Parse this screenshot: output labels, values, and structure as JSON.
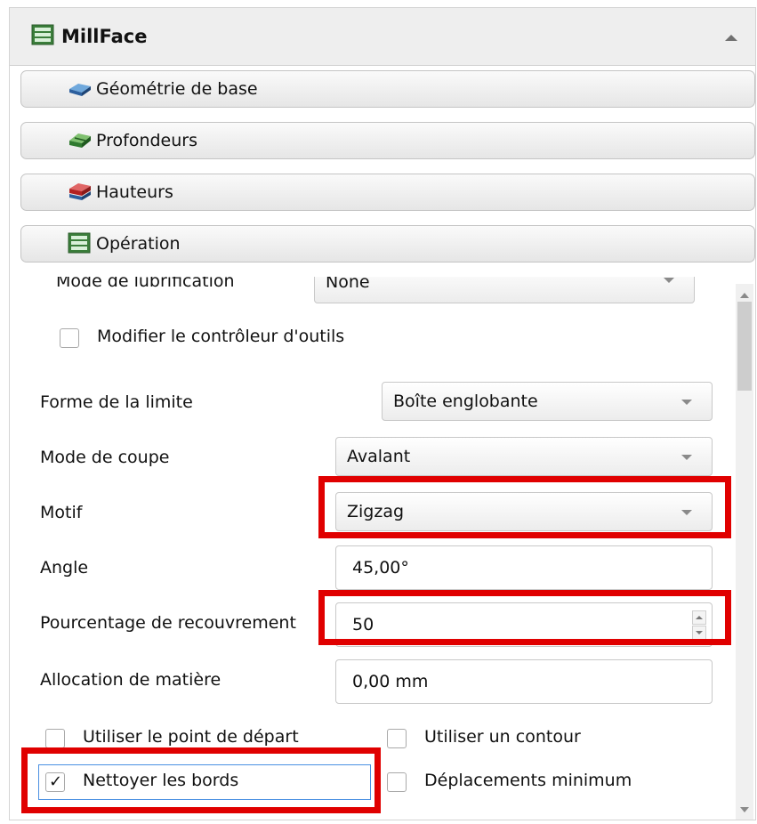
{
  "panel": {
    "title": "MillFace",
    "icon": "millface-doc-icon",
    "collapse_icon": "chevron-up-icon"
  },
  "sections": [
    {
      "label": "Géométrie de base",
      "icon": "blue-block-icon"
    },
    {
      "label": "Profondeurs",
      "icon": "green-block-icon"
    },
    {
      "label": "Hauteurs",
      "icon": "red-block-icon"
    },
    {
      "label": "Opération",
      "icon": "doc-stack-icon"
    }
  ],
  "operation": {
    "lubrication": {
      "label": "Mode de lubrification",
      "value": "None"
    },
    "modify_tool_controller": {
      "label": "Modifier le contrôleur d'outils",
      "checked": false
    },
    "boundary_shape": {
      "label": "Forme de la limite",
      "value": "Boîte englobante"
    },
    "cut_mode": {
      "label": "Mode de coupe",
      "value": "Avalant"
    },
    "pattern": {
      "label": "Motif",
      "value": "Zigzag"
    },
    "angle": {
      "label": "Angle",
      "value": "45,00°"
    },
    "step_over": {
      "label": "Pourcentage de recouvrement",
      "value": "50"
    },
    "material_allowance": {
      "label": "Allocation de matière",
      "value": "0,00 mm"
    },
    "use_start_point": {
      "label": "Utiliser le point de départ",
      "checked": false
    },
    "use_outline": {
      "label": "Utiliser un contour",
      "checked": false
    },
    "clear_edges": {
      "label": "Nettoyer les bords",
      "checked": true
    },
    "min_travel": {
      "label": "Déplacements minimum",
      "checked": false
    }
  },
  "check_glyph": "✓",
  "colors": {
    "highlight": "#e00000",
    "focus": "#4a90e2"
  }
}
